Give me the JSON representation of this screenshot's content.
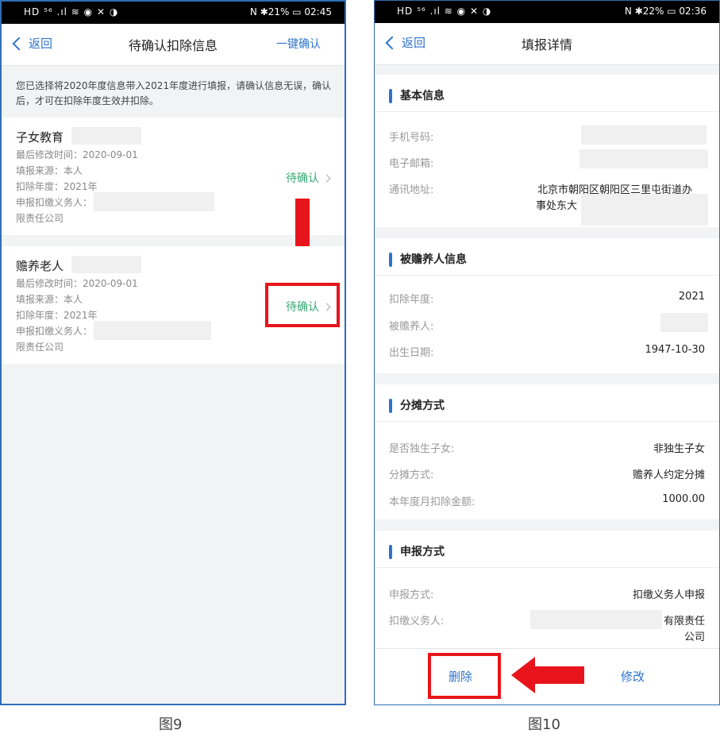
{
  "left": {
    "status_left": "HD ⁵⁶ .ıl ≋ ◉ ✕ ◑",
    "status_right": "N ✱21% ▭ 02:45",
    "back_label": "返回",
    "title": "待确认扣除信息",
    "right_action": "一键确认",
    "notice_line1": "您已选择将2020年度信息带入2021年度进行填报，请确认信息无误，确认",
    "notice_line2": "后，才可在扣除年度生效并扣除。",
    "items": [
      {
        "title": "子女教育",
        "modified": "最后修改时间：2020-09-01",
        "source": "填报来源：本人",
        "year": "扣除年度：2021年",
        "agent_label": "申报扣缴义务人：",
        "agent_suffix": "限责任公司",
        "status": "待确认"
      },
      {
        "title": "赡养老人",
        "modified": "最后修改时间：2020-09-01",
        "source": "填报来源：本人",
        "year": "扣除年度：2021年",
        "agent_label": "申报扣缴义务人：",
        "agent_suffix": "限责任公司",
        "status": "待确认"
      }
    ],
    "caption": "图9"
  },
  "right": {
    "status_left": "HD ⁵⁶ .ıl ≋ ◉ ✕ ◑",
    "status_right": "N ✱22% ▭ 02:36",
    "back_label": "返回",
    "title": "填报详情",
    "sections": {
      "basic": {
        "title": "基本信息",
        "phone_label": "手机号码:",
        "email_label": "电子邮箱:",
        "address_label": "通讯地址:",
        "address_line1": "北京市朝阳区朝阳区三里屯街道办",
        "address_line2": "事处东大"
      },
      "dependent": {
        "title": "被赡养人信息",
        "year_label": "扣除年度:",
        "year_value": "2021",
        "person_label": "被赡养人:",
        "birth_label": "出生日期:",
        "birth_value": "1947-10-30"
      },
      "split": {
        "title": "分摊方式",
        "only_child_label": "是否独生子女:",
        "only_child_value": "非独生子女",
        "method_label": "分摊方式:",
        "method_value": "赡养人约定分摊",
        "amount_label": "本年度月扣除金额:",
        "amount_value": "1000.00"
      },
      "report": {
        "title": "申报方式",
        "method_label": "申报方式:",
        "method_value": "扣缴义务人申报",
        "agent_label": "扣缴义务人:",
        "agent_line1": "有限责任",
        "agent_line2": "公司"
      }
    },
    "delete_label": "删除",
    "edit_label": "修改",
    "caption": "图10"
  },
  "colors": {
    "accent": "#2f73c9",
    "confirm_green": "#3aa775",
    "highlight_red": "#e8141b"
  }
}
